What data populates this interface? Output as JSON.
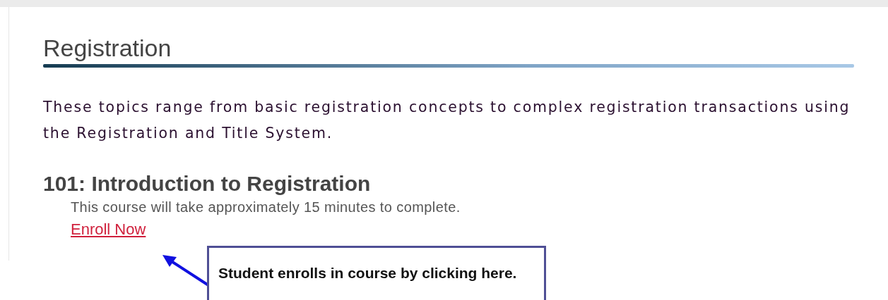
{
  "section": {
    "title": "Registration",
    "intro": "These topics range from basic registration concepts to complex registration transactions using the Registration and Title System."
  },
  "course": {
    "title": "101: Introduction to Registration",
    "description": "This course will take approximately 15 minutes to complete.",
    "link": "Enroll Now"
  },
  "callout": {
    "text": "Student enrolls in course by clicking here."
  }
}
